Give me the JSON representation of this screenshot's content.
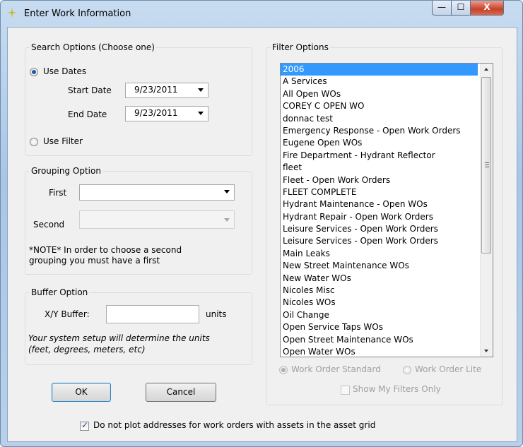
{
  "window": {
    "title": "Enter Work Information",
    "icon": "sparkle-icon",
    "controls": {
      "minimize": "—",
      "maximize": "☐",
      "close": "X"
    }
  },
  "search_options": {
    "legend": "Search Options (Choose one)",
    "use_dates": {
      "label": "Use Dates",
      "selected": true
    },
    "start_date": {
      "label": "Start Date",
      "value": "9/23/2011"
    },
    "end_date": {
      "label": "End Date",
      "value": "9/23/2011"
    },
    "use_filter": {
      "label": "Use Filter",
      "selected": false
    }
  },
  "grouping_option": {
    "legend": "Grouping Option",
    "first_label": "First",
    "first_value": "",
    "second_label": "Second",
    "second_value": "",
    "note": "*NOTE* In order to choose a second grouping you must have a first",
    "note_line1": "*NOTE* In order to choose a second",
    "note_line2": "grouping you must have a first"
  },
  "buffer_option": {
    "legend": "Buffer Option",
    "xy_label": "X/Y Buffer:",
    "xy_value": "",
    "units_label": "units",
    "help_line1": "Your system setup will determine the units",
    "help_line2": "(feet, degrees, meters, etc)"
  },
  "buttons": {
    "ok": "OK",
    "cancel": "Cancel"
  },
  "filter_options": {
    "legend": "Filter Options",
    "items": [
      "2006",
      "A Services",
      "All Open WOs",
      "COREY C OPEN WO",
      "donnac test",
      "Emergency Response - Open Work Orders",
      "Eugene Open WOs",
      "Fire Department - Hydrant Reflector",
      "fleet",
      "Fleet - Open Work Orders",
      "FLEET COMPLETE",
      "Hydrant Maintenance - Open WOs",
      "Hydrant Repair - Open Work Orders",
      "Leisure Services - Open Work Orders",
      "Leisure Services - Open Work Orders",
      "Main Leaks",
      "New Street Maintenance WOs",
      "New Water WOs",
      "Nicoles Misc",
      "Nicoles WOs",
      "Oil Change",
      "Open Service Taps WOs",
      "Open Street Maintenance WOs",
      "Open Water WOs"
    ],
    "selected_index": 0,
    "work_order_standard": {
      "label": "Work Order Standard",
      "selected": true
    },
    "work_order_lite": {
      "label": "Work Order Lite",
      "selected": false
    },
    "show_my_filters": {
      "label": "Show My Filters Only",
      "checked": false
    }
  },
  "no_plot_addresses": {
    "label": "Do not plot addresses for work orders with assets in the asset grid",
    "checked": true
  }
}
